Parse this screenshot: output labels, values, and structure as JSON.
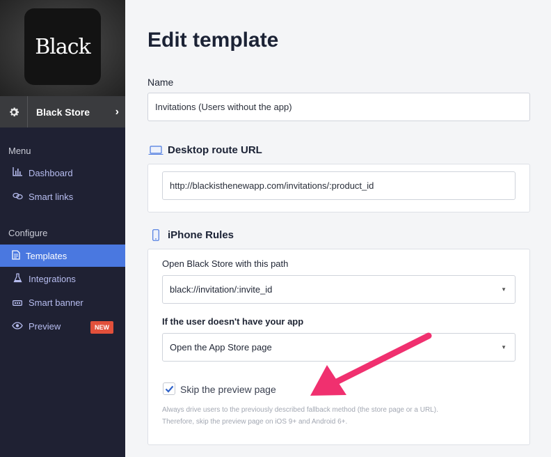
{
  "app": {
    "logo_text": "Black",
    "store_name": "Black Store",
    "chevron": "›"
  },
  "sidebar": {
    "menu_heading": "Menu",
    "menu_items": [
      {
        "label": "Dashboard",
        "icon": "bar-chart-icon"
      },
      {
        "label": "Smart links",
        "icon": "link-icon"
      }
    ],
    "configure_heading": "Configure",
    "configure_items": [
      {
        "label": "Templates",
        "icon": "document-icon",
        "active": true
      },
      {
        "label": "Integrations",
        "icon": "flask-icon"
      },
      {
        "label": "Smart banner",
        "icon": "banner-icon"
      },
      {
        "label": "Preview",
        "icon": "eye-icon",
        "badge": "NEW"
      }
    ]
  },
  "main": {
    "title": "Edit template",
    "name_label": "Name",
    "name_value": "Invitations (Users without the app)",
    "desktop": {
      "heading": "Desktop route URL",
      "icon": "laptop-icon",
      "url_value": "http://blackisthenewapp.com/invitations/:product_id"
    },
    "iphone": {
      "heading": "iPhone Rules",
      "icon": "phone-icon",
      "path_label": "Open Black Store with this path",
      "path_value": "black://invitation/:invite_id",
      "fallback_label": "If the user doesn't have your app",
      "fallback_value": "Open the App Store page",
      "skip_label": "Skip the preview page",
      "skip_checked": true,
      "help_line1": "Always drive users to the previously described fallback method (the store page or a URL).",
      "help_line2": "Therefore, skip the preview page on iOS 9+ and Android 6+."
    }
  },
  "colors": {
    "sidebar_bg": "#1f2133",
    "active_nav": "#4a78e0",
    "badge": "#e2503b",
    "arrow": "#f0306f",
    "nav_text": "#b7bdf0"
  }
}
